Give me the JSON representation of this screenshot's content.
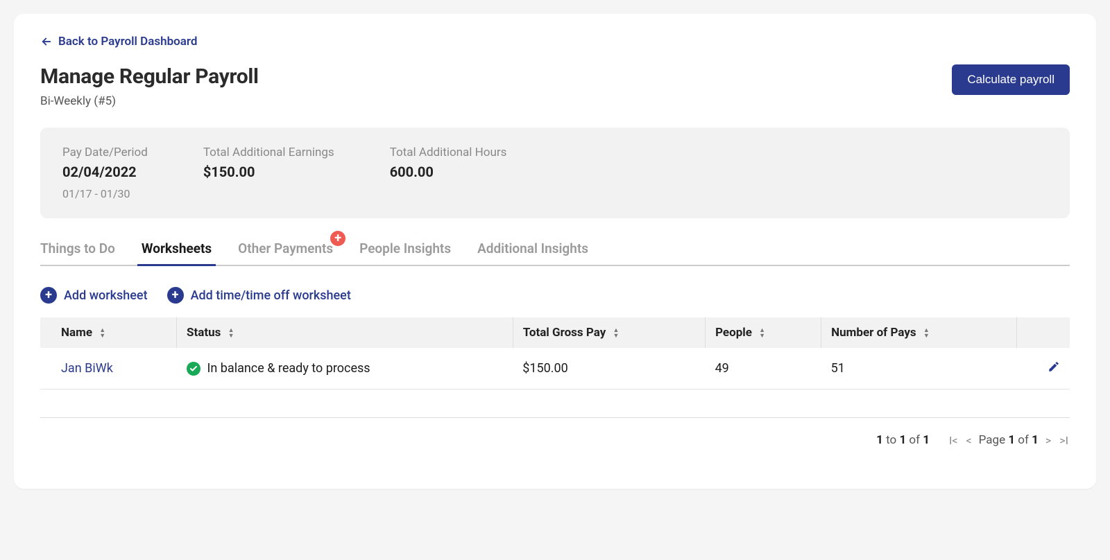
{
  "back_link": "Back to Payroll Dashboard",
  "page_title": "Manage Regular Payroll",
  "page_subtitle": "Bi-Weekly (#5)",
  "primary_action": "Calculate payroll",
  "summary": {
    "pay_date_label": "Pay Date/Period",
    "pay_date_value": "02/04/2022",
    "pay_date_range": "01/17 - 01/30",
    "earnings_label": "Total Additional Earnings",
    "earnings_value": "$150.00",
    "hours_label": "Total Additional Hours",
    "hours_value": "600.00"
  },
  "tabs": {
    "things": "Things to Do",
    "worksheets": "Worksheets",
    "other_payments": "Other Payments",
    "people_insights": "People Insights",
    "additional_insights": "Additional Insights"
  },
  "actions": {
    "add_worksheet": "Add worksheet",
    "add_time_worksheet": "Add time/time off worksheet"
  },
  "table": {
    "headers": {
      "name": "Name",
      "status": "Status",
      "gross": "Total Gross Pay",
      "people": "People",
      "num_pays": "Number of Pays"
    },
    "row": {
      "name": "Jan BiWk",
      "status": "In balance & ready to process",
      "gross": "$150.00",
      "people": "49",
      "num_pays": "51"
    }
  },
  "pagination": {
    "from": "1",
    "to_word": " to ",
    "to": "1",
    "of_word": " of ",
    "total": "1",
    "page_word": "Page ",
    "page": "1",
    "of_word2": " of ",
    "pages": "1"
  }
}
